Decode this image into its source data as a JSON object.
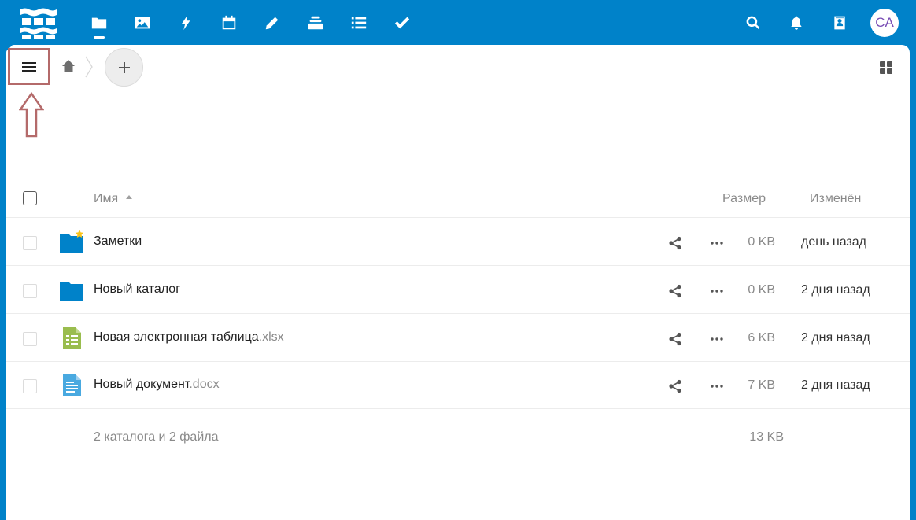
{
  "header": {
    "logo_icon": "nextcloud-logo",
    "apps": [
      {
        "name": "files",
        "icon": "folder-icon",
        "active": true
      },
      {
        "name": "photos",
        "icon": "image-icon",
        "active": false
      },
      {
        "name": "activity",
        "icon": "lightning-icon",
        "active": false
      },
      {
        "name": "calendar",
        "icon": "calendar-icon",
        "active": false
      },
      {
        "name": "notes",
        "icon": "pencil-icon",
        "active": false
      },
      {
        "name": "deck",
        "icon": "stack-icon",
        "active": false
      },
      {
        "name": "tasks",
        "icon": "list-icon",
        "active": false
      },
      {
        "name": "check",
        "icon": "check-icon",
        "active": false
      }
    ],
    "right_icons": [
      "search-icon",
      "bell-icon",
      "contacts-icon"
    ],
    "avatar_initials": "CA",
    "accent_color": "#0082c9"
  },
  "toolbar": {
    "menu_icon": "hamburger-icon",
    "home_icon": "home-icon",
    "add_icon": "plus-icon",
    "view_icon": "grid-view-icon"
  },
  "table": {
    "columns": {
      "name": "Имя",
      "size": "Размер",
      "modified": "Изменён"
    },
    "rows": [
      {
        "name": "Заметки",
        "ext": "",
        "type": "folder",
        "favorite": true,
        "size": "0 KB",
        "modified": "день назад"
      },
      {
        "name": "Новый каталог",
        "ext": "",
        "type": "folder",
        "favorite": false,
        "size": "0 KB",
        "modified": "2 дня назад"
      },
      {
        "name": "Новая электронная таблица",
        "ext": ".xlsx",
        "type": "spreadsheet",
        "favorite": false,
        "size": "6 KB",
        "modified": "2 дня назад"
      },
      {
        "name": "Новый документ",
        "ext": ".docx",
        "type": "document",
        "favorite": false,
        "size": "7 KB",
        "modified": "2 дня назад"
      }
    ],
    "summary": "2 каталога и 2 файла",
    "summary_size": "13 KB"
  }
}
